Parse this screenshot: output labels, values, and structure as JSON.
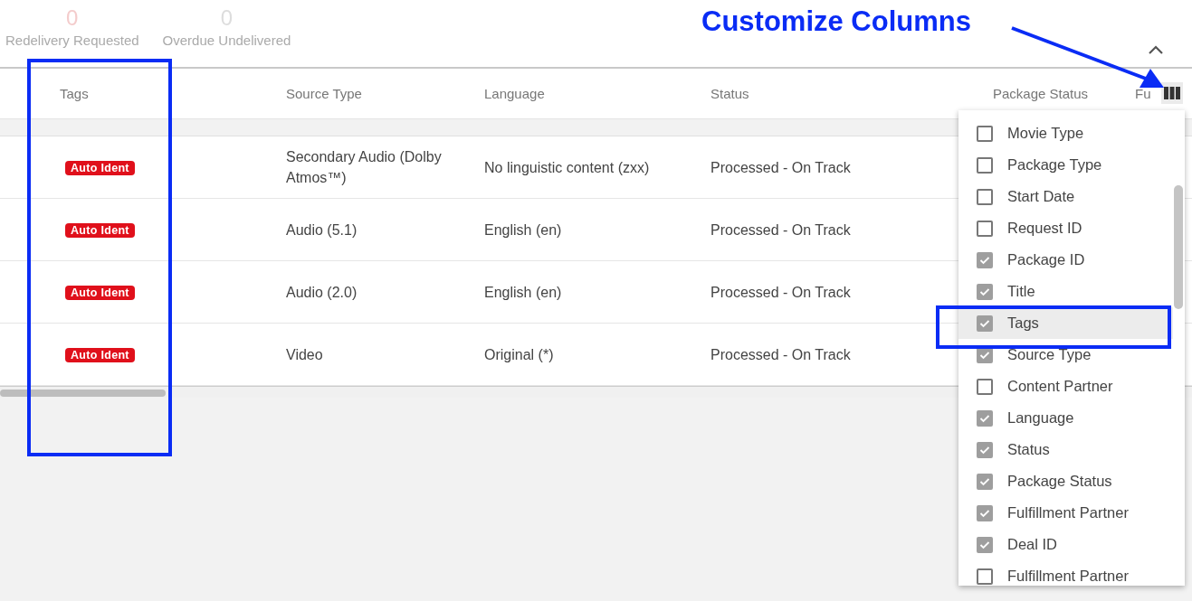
{
  "stats": [
    {
      "value": "0",
      "label": "Redelivery Requested",
      "kind": "alert"
    },
    {
      "value": "0",
      "label": "Overdue Undelivered",
      "kind": "plain"
    }
  ],
  "table": {
    "columns": [
      "Tags",
      "Source Type",
      "Language",
      "Status",
      "Package Status",
      "Fu"
    ],
    "rows": [
      {
        "tag": "Auto Ident",
        "source_type": "Secondary Audio (Dolby Atmos™)",
        "language": "No linguistic content (zxx)",
        "status": "Processed - On Track"
      },
      {
        "tag": "Auto Ident",
        "source_type": "Audio (5.1)",
        "language": "English (en)",
        "status": "Processed - On Track"
      },
      {
        "tag": "Auto Ident",
        "source_type": "Audio (2.0)",
        "language": "English (en)",
        "status": "Processed - On Track"
      },
      {
        "tag": "Auto Ident",
        "source_type": "Video",
        "language": "Original (*)",
        "status": "Processed - On Track"
      }
    ]
  },
  "column_menu": {
    "items": [
      {
        "label": "Movie Type",
        "checked": false,
        "selected": false
      },
      {
        "label": "Package Type",
        "checked": false,
        "selected": false
      },
      {
        "label": "Start Date",
        "checked": false,
        "selected": false
      },
      {
        "label": "Request ID",
        "checked": false,
        "selected": false
      },
      {
        "label": "Package ID",
        "checked": true,
        "selected": false
      },
      {
        "label": "Title",
        "checked": true,
        "selected": false
      },
      {
        "label": "Tags",
        "checked": true,
        "selected": true
      },
      {
        "label": "Source Type",
        "checked": true,
        "selected": false
      },
      {
        "label": "Content Partner",
        "checked": false,
        "selected": false
      },
      {
        "label": "Language",
        "checked": true,
        "selected": false
      },
      {
        "label": "Status",
        "checked": true,
        "selected": false
      },
      {
        "label": "Package Status",
        "checked": true,
        "selected": false
      },
      {
        "label": "Fulfillment Partner",
        "checked": true,
        "selected": false
      },
      {
        "label": "Deal ID",
        "checked": true,
        "selected": false
      },
      {
        "label": "Fulfillment Partner",
        "checked": false,
        "selected": false
      }
    ]
  },
  "annotation": {
    "caption": "Customize Columns"
  }
}
